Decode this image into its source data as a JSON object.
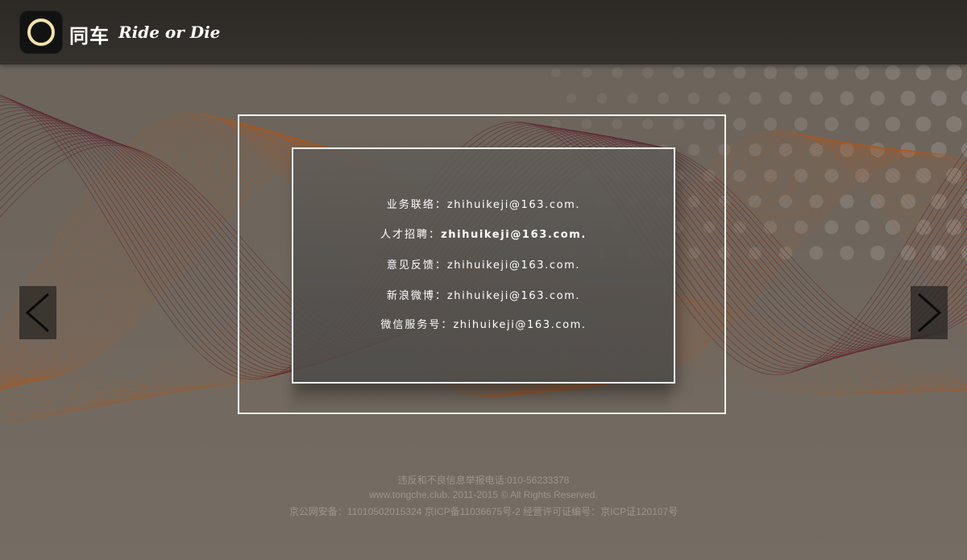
{
  "brand": {
    "name_cn": "同车",
    "slogan": "Ride or Die"
  },
  "contacts": [
    {
      "label": "业务联络：",
      "value": "zhihuikeji@163.com."
    },
    {
      "label": "人才招聘：",
      "value": "zhihuikeji@163.com."
    },
    {
      "label": "意见反馈：",
      "value": "zhihuikeji@163.com."
    },
    {
      "label": "新浪微博：",
      "value": "zhihuikeji@163.com."
    },
    {
      "label": "微信服务号：",
      "value": "zhihuikeji@163.com."
    }
  ],
  "nav": {
    "prev_icon": "chevron-left-icon",
    "next_icon": "chevron-right-icon"
  },
  "footer": {
    "report_line": "违反和不良信息举报电话:010-56233378",
    "copyright": "www.tongche.club. 2011-2015 © All Rights Reserved.",
    "license": "京公网安备：11010502015324 京ICP备11036675号-2 经营许可证编号：京ICP证120107号"
  },
  "colors": {
    "header_bg": "#2c2925",
    "accent_ring": "#f3e3a8",
    "ribbon_orange": "#b0561c",
    "ribbon_maroon": "#5a1424"
  }
}
